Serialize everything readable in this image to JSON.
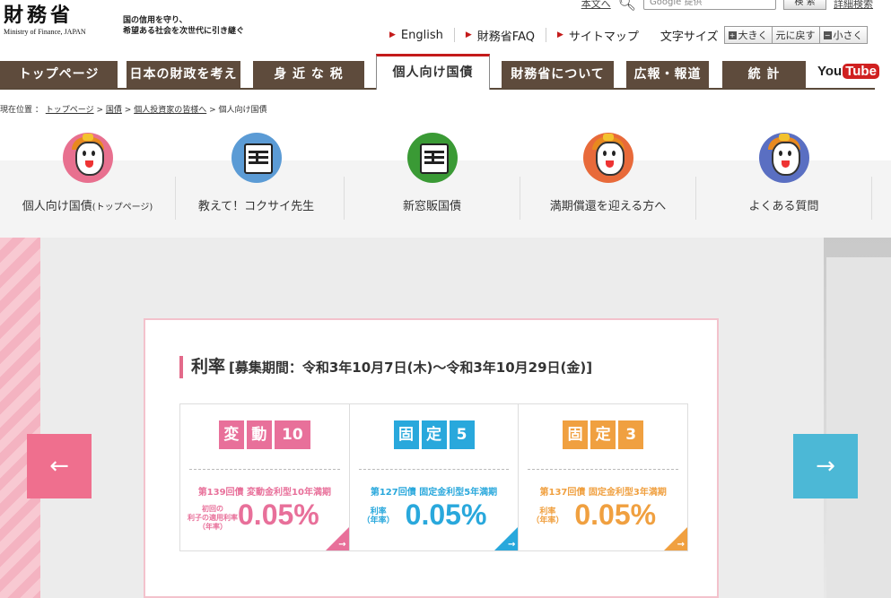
{
  "header": {
    "logo_kanji": "財務省",
    "logo_en": "Ministry of Finance, JAPAN",
    "tagline_1": "国の信用を守り、",
    "tagline_2": "希望ある社会を次世代に引き継ぐ",
    "top_link_1": "本文へ",
    "search_placeholder": "Google 提供",
    "search_button": "検 索",
    "top_link_2": "詳細検索"
  },
  "utility": {
    "english": "English",
    "faq": "財務省FAQ",
    "sitemap": "サイトマップ",
    "font_size_label": "文字サイズ",
    "fs_large": "大きく",
    "fs_reset": "元に戻す",
    "fs_small": "小さく"
  },
  "tabs": [
    {
      "label": "トップページ"
    },
    {
      "label": "日本の財政を考える"
    },
    {
      "label": "身 近 な 税"
    },
    {
      "label": "個人向け国債"
    },
    {
      "label": "財務省について"
    },
    {
      "label": "広報・報道"
    },
    {
      "label": "統 計"
    }
  ],
  "youtube": {
    "you": "You",
    "tube": "Tube"
  },
  "breadcrumb": {
    "prefix": "現在位置 ：",
    "items": [
      "トップページ",
      "国債",
      "個人投資家の皆様へ",
      "個人向け国債"
    ],
    "sep": ">"
  },
  "submenu": [
    {
      "label": "個人向け国債",
      "small": "(トップページ)",
      "icon": "mascot-girl-icon",
      "color": "#e8708f"
    },
    {
      "label": "教えて！コクサイ先生",
      "small": "",
      "icon": "mascot-teacher-icon",
      "color": "#5b9bd5"
    },
    {
      "label": "新窓販国債",
      "small": "",
      "icon": "mascot-green-icon",
      "color": "#3a9a35"
    },
    {
      "label": "満期償還を迎える方へ",
      "small": "",
      "icon": "mascot-girl-icon",
      "color": "#e86a3a"
    },
    {
      "label": "よくある質問",
      "small": "",
      "icon": "mascot-girl-icon",
      "color": "#5a6fc2"
    }
  ],
  "banner": {
    "title": "利率",
    "period": "[募集期間：令和3年10月7日(木)〜令和3年10月29日(金)]",
    "rates": [
      {
        "badge": [
          "変",
          "動",
          "10"
        ],
        "color": "#e8709a",
        "issue": "第139回債 変動金利型10年満期",
        "rate_label": "初回の\n利子の適用利率\n（年率）",
        "rate": "0.05%"
      },
      {
        "badge": [
          "固",
          "定",
          "5"
        ],
        "color": "#29a8dc",
        "issue": "第127回債 固定金利型5年満期",
        "rate_label": "利率\n（年率）",
        "rate": "0.05%"
      },
      {
        "badge": [
          "固",
          "定",
          "3"
        ],
        "color": "#f0a040",
        "issue": "第137回債 固定金利型3年満期",
        "rate_label": "利率\n（年率）",
        "rate": "0.05%"
      }
    ],
    "prev": "←",
    "next": "→"
  },
  "colors": {
    "tab_bg": "#5e4b3c",
    "accent_red": "#c41a1a",
    "prev_btn": "#ef6f8e",
    "next_btn": "#4cb8d6"
  }
}
